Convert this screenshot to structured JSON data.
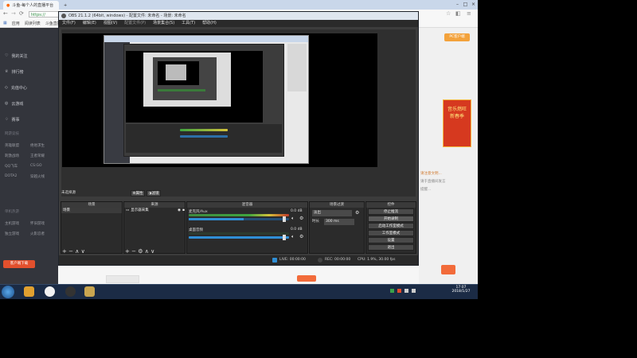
{
  "browser": {
    "tabs": [
      {
        "label": "斗鱼-每个人的直播平台"
      },
      {
        "label": "OBS"
      }
    ],
    "url": "https://",
    "bookmarks": [
      "应用",
      "阅读列表",
      "斗鱼直播"
    ],
    "sidebar": [
      {
        "label": "我的关注"
      },
      {
        "label": "排行榜"
      },
      {
        "label": "充值中心"
      },
      {
        "label": "云游戏"
      },
      {
        "label": "赛事"
      }
    ],
    "sidebar_section1": "网游竞技",
    "sidebar_sub1": [
      "英雄联盟",
      "绝地求生",
      "刺激战场",
      "王者荣耀",
      "QQ飞车",
      "CS:GO",
      "DOTA2",
      "穿越火线"
    ],
    "sidebar_section2": "单机热游",
    "sidebar_sub2": [
      "主机游戏",
      "怀旧游戏",
      "独立游戏",
      "火影忍者"
    ],
    "sidebar_bottom": "客户端下载",
    "promo": {
      "title": "音乐燃旺",
      "line2": "新春季",
      "badge": "PC客户端"
    },
    "site_text": [
      "请注意文明...",
      "请于直播间发言",
      "提醒..."
    ],
    "taskbar_time": "17:07",
    "taskbar_date": "2018/1/27"
  },
  "obs": {
    "title": "OBS 21.1.2 (64bit, windows) - 配置文件: 未命名 - 场景: 未命名",
    "menu": [
      "文件(F)",
      "编辑(E)",
      "视图(V)",
      "配置文件(P)",
      "场景集合(S)",
      "工具(T)",
      "帮助(H)"
    ],
    "selection_label": "未选择源",
    "props_button": "属性",
    "filter_button": "滤镜",
    "scenes_header": "场景",
    "scene_items": [
      "场景"
    ],
    "sources_header": "来源",
    "source_items": [
      "显示器采集"
    ],
    "mixer_header": "混音器",
    "mixer_channels": [
      {
        "name": "麦克风/Aux",
        "db": "0.0 dB",
        "level": 0.55
      },
      {
        "name": "桌面音频",
        "db": "0.0 dB",
        "level": 0.0
      }
    ],
    "transition_header": "场景过渡",
    "transition_value": "淡出",
    "duration_label": "时长",
    "duration_value": "300 ms",
    "controls_header": "控件",
    "controls": [
      "停止推流",
      "开始录制",
      "启动工作室模式",
      "工作室模式",
      "设置",
      "退出"
    ],
    "status": {
      "live": "LIVE: 00:00:00",
      "rec": "REC: 00:00:00",
      "cpu": "CPU: 1.9%, 30.00 fps"
    }
  }
}
